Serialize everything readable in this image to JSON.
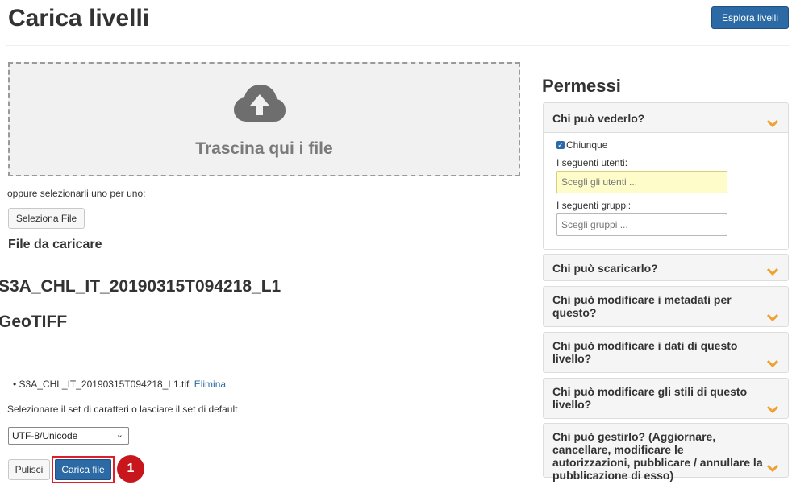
{
  "header": {
    "title": "Carica livelli",
    "browse_button": "Esplora livelli"
  },
  "upload": {
    "dropzone_text": "Trascina qui i file",
    "or_text": "oppure selezionarli uno per uno:",
    "select_button": "Seleziona File",
    "files_heading": "File da caricare",
    "file_name_heading": "S3A_CHL_IT_20190315T094218_L1",
    "file_type_heading": "GeoTIFF",
    "files": [
      {
        "name": "S3A_CHL_IT_20190315T094218_L1.tif",
        "action": "Elimina"
      }
    ],
    "charset_label": "Selezionare il set di caratteri o lasciare il set di default",
    "charset_value": "UTF-8/Unicode",
    "clear_button": "Pulisci",
    "upload_button": "Carica file",
    "step_badge": "1"
  },
  "permissions": {
    "title": "Permessi",
    "panels": [
      {
        "label": "Chi può vederlo?",
        "checkbox_label": "Chiunque",
        "users_label": "I seguenti utenti:",
        "users_placeholder": "Scegli gli utenti ...",
        "groups_label": "I seguenti gruppi:",
        "groups_placeholder": "Scegli gruppi ..."
      },
      {
        "label": "Chi può scaricarlo?"
      },
      {
        "label": "Chi può modificare i metadati per questo?"
      },
      {
        "label": "Chi può modificare i dati di questo livello?"
      },
      {
        "label": "Chi può modificare gli stili di questo livello?"
      },
      {
        "label": "Chi può gestirlo? (Aggiornare, cancellare, modificare le autorizzazioni, pubblicare / annullare la pubblicazione di esso)"
      }
    ]
  },
  "colors": {
    "primary_button": "#2b6aa5",
    "chevron": "#f0a030",
    "highlight": "#e11d2a"
  },
  "icons": {
    "dropzone": "cloud-upload-icon",
    "panel_toggle": "chevron-down-icon"
  }
}
